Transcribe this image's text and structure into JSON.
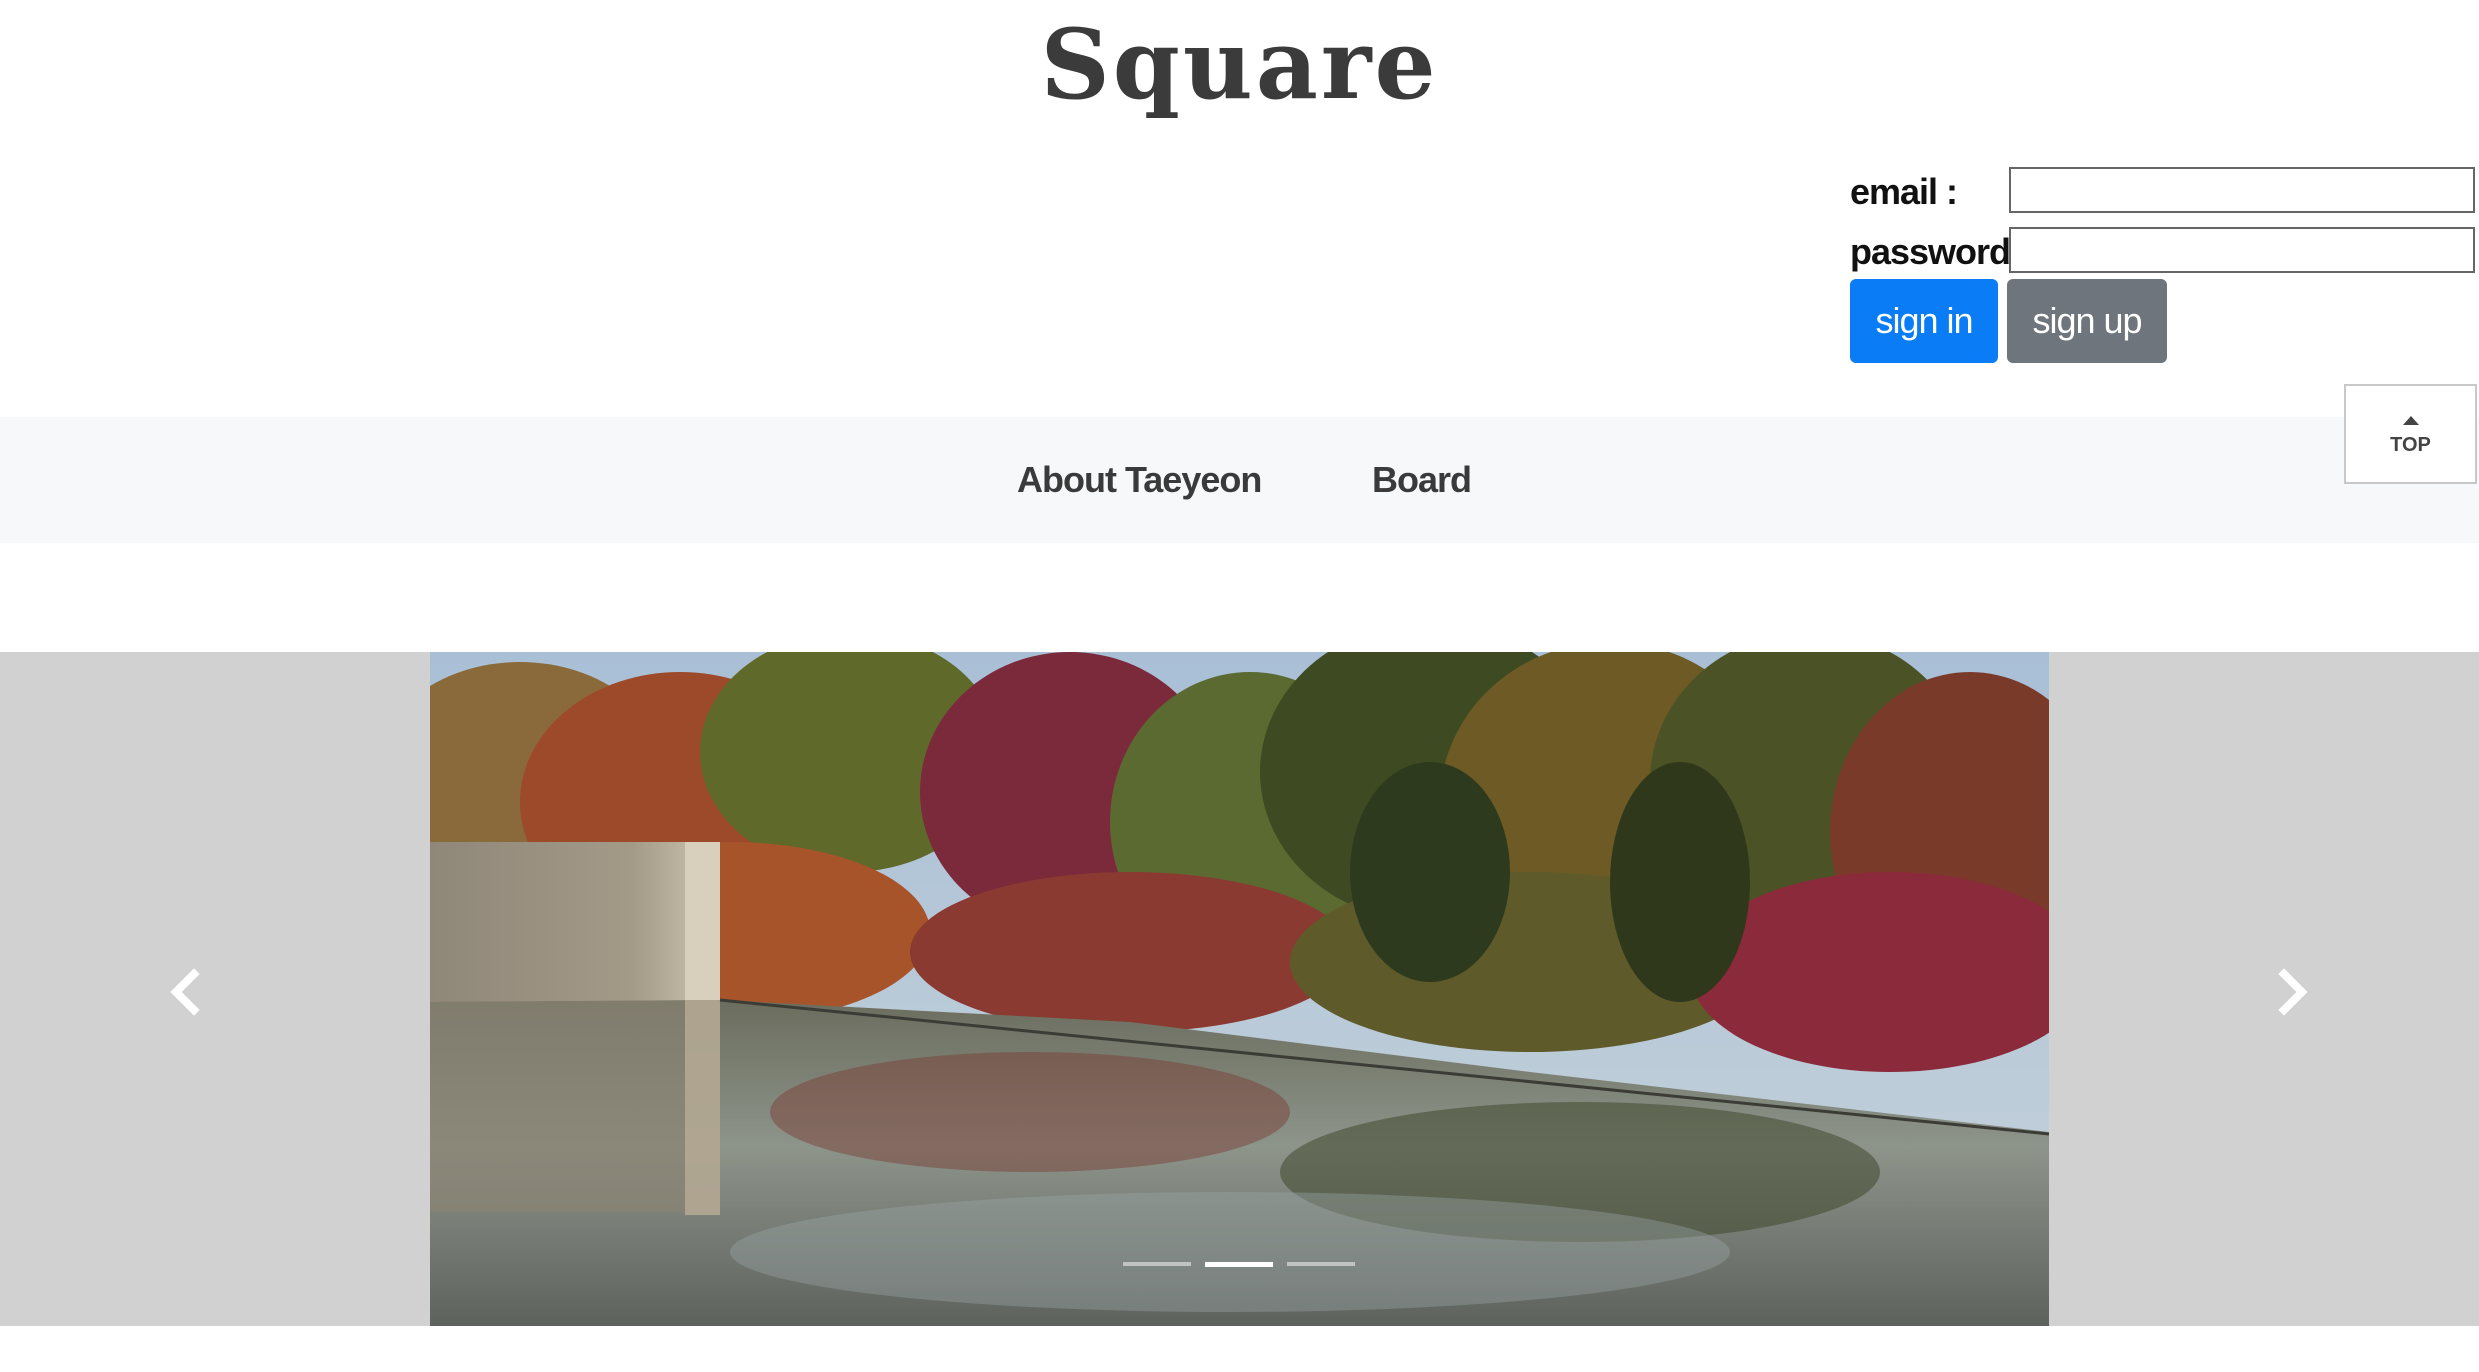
{
  "header": {
    "title": "Square"
  },
  "login": {
    "email_label": "email :",
    "password_label": "password :",
    "email_value": "",
    "password_value": "",
    "signin_label": "sign in",
    "signup_label": "sign up",
    "colors": {
      "signin": "#0a7cf5",
      "signup": "#6e757c"
    }
  },
  "nav": {
    "items": [
      {
        "label": "About Taeyeon"
      },
      {
        "label": "Board"
      }
    ]
  },
  "top_button": {
    "label": "TOP",
    "icon": "arrow-up-icon"
  },
  "carousel": {
    "slide_count": 3,
    "active_index": 1,
    "prev_icon": "chevron-left-icon",
    "next_icon": "chevron-right-icon",
    "image": "autumn-trees-reflecting-pool"
  }
}
